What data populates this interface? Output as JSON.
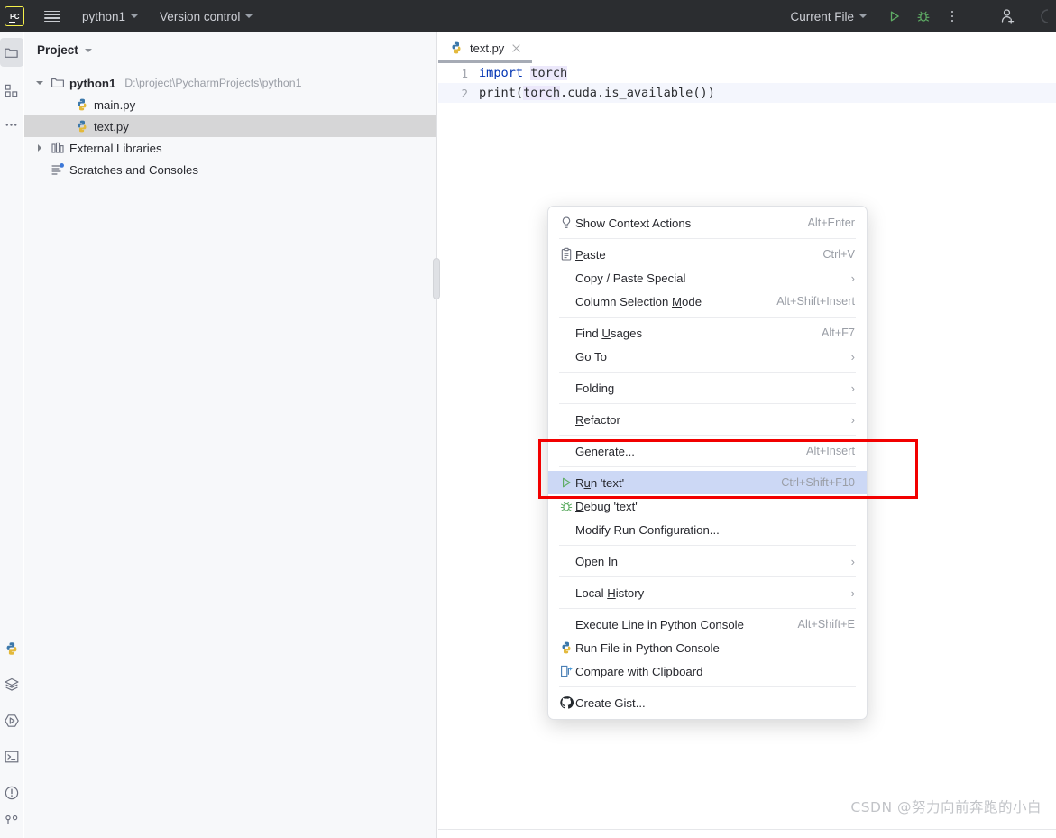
{
  "titlebar": {
    "logo_text": "PC",
    "logo_name": "pycharm-logo",
    "menu_icon": "hamburger-menu-icon",
    "project_name": "python1",
    "version_control": "Version control",
    "run_config": "Current File",
    "run_icon": "run-triangle-icon",
    "debug_icon": "debug-bug-icon",
    "more_icon": "more-vertical-icon",
    "account_icon": "add-user-icon",
    "accent_run_green": "#5fad65",
    "bg": "#2b2d30"
  },
  "rail": {
    "top": [
      {
        "name": "project-folder-icon",
        "label": "Project",
        "selected": true
      },
      {
        "name": "structure-icon",
        "label": "Structure",
        "selected": false
      },
      {
        "name": "more-tool-windows-icon",
        "label": "More",
        "selected": false
      }
    ],
    "bottom": [
      {
        "name": "python-packages-icon",
        "label": "Python Packages"
      },
      {
        "name": "database-layers-icon",
        "label": "Database"
      },
      {
        "name": "run-tool-icon",
        "label": "Run"
      },
      {
        "name": "terminal-icon",
        "label": "Terminal"
      },
      {
        "name": "problems-icon",
        "label": "Problems"
      },
      {
        "name": "git-branch-icon",
        "label": "Git"
      }
    ]
  },
  "project": {
    "header": "Project",
    "tree": [
      {
        "label": "python1",
        "path": "D:\\project\\PycharmProjects\\python1",
        "icon": "folder-icon",
        "twist": "open",
        "depth": 0,
        "bold": true,
        "selected": false
      },
      {
        "label": "main.py",
        "path": "",
        "icon": "python-file-icon",
        "twist": "none",
        "depth": 1,
        "bold": false,
        "selected": false
      },
      {
        "label": "text.py",
        "path": "",
        "icon": "python-file-icon",
        "twist": "none",
        "depth": 1,
        "bold": false,
        "selected": true
      },
      {
        "label": "External Libraries",
        "path": "",
        "icon": "library-icon",
        "twist": "closed",
        "depth": 0,
        "bold": false,
        "selected": false
      },
      {
        "label": "Scratches and Consoles",
        "path": "",
        "icon": "scratches-icon",
        "twist": "none",
        "depth": 0,
        "bold": false,
        "selected": false
      }
    ]
  },
  "editor": {
    "tab": {
      "label": "text.py",
      "icon": "python-file-icon",
      "close": "close-tab-icon"
    },
    "lines": [
      {
        "num": "1",
        "caret": false
      },
      {
        "num": "2",
        "caret": true
      }
    ],
    "code": {
      "line1_kw": "import",
      "line1_ident": "torch",
      "line2": "print(torch.cuda.is_available())",
      "line2_pre": "print(",
      "line2_ident": "torch",
      "line2_post": ".cuda.is_available())"
    }
  },
  "context_menu": {
    "items": [
      {
        "kind": "item",
        "icon": "lightbulb-icon",
        "label": "Show Context Actions",
        "accel": "Alt+Enter",
        "arrow": false,
        "selected": false
      },
      {
        "kind": "sep"
      },
      {
        "kind": "item",
        "icon": "clipboard-paste-icon",
        "label": "Paste",
        "mnemonic": "P",
        "accel": "Ctrl+V",
        "arrow": false,
        "selected": false
      },
      {
        "kind": "item",
        "icon": "",
        "label": "Copy / Paste Special",
        "accel": "",
        "arrow": true,
        "selected": false
      },
      {
        "kind": "item",
        "icon": "",
        "label": "Column Selection Mode",
        "mnemonic": "M",
        "accel": "Alt+Shift+Insert",
        "arrow": false,
        "selected": false
      },
      {
        "kind": "sep"
      },
      {
        "kind": "item",
        "icon": "",
        "label": "Find Usages",
        "mnemonic": "U",
        "accel": "Alt+F7",
        "arrow": false,
        "selected": false
      },
      {
        "kind": "item",
        "icon": "",
        "label": "Go To",
        "accel": "",
        "arrow": true,
        "selected": false
      },
      {
        "kind": "sep"
      },
      {
        "kind": "item",
        "icon": "",
        "label": "Folding",
        "accel": "",
        "arrow": true,
        "selected": false
      },
      {
        "kind": "sep"
      },
      {
        "kind": "item",
        "icon": "",
        "label": "Refactor",
        "mnemonic": "R",
        "accel": "",
        "arrow": true,
        "selected": false
      },
      {
        "kind": "sep"
      },
      {
        "kind": "item",
        "icon": "",
        "label": "Generate...",
        "accel": "Alt+Insert",
        "arrow": false,
        "selected": false
      },
      {
        "kind": "sep"
      },
      {
        "kind": "item",
        "icon": "run-triangle-icon",
        "label": "Run 'text'",
        "mnemonic": "u",
        "accel": "Ctrl+Shift+F10",
        "arrow": false,
        "selected": true
      },
      {
        "kind": "item",
        "icon": "debug-bug-icon",
        "label": "Debug 'text'",
        "mnemonic": "D",
        "accel": "",
        "arrow": false,
        "selected": false
      },
      {
        "kind": "item",
        "icon": "",
        "label": "Modify Run Configuration...",
        "accel": "",
        "arrow": false,
        "selected": false
      },
      {
        "kind": "sep"
      },
      {
        "kind": "item",
        "icon": "",
        "label": "Open In",
        "accel": "",
        "arrow": true,
        "selected": false
      },
      {
        "kind": "sep"
      },
      {
        "kind": "item",
        "icon": "",
        "label": "Local History",
        "mnemonic": "H",
        "accel": "",
        "arrow": true,
        "selected": false
      },
      {
        "kind": "sep"
      },
      {
        "kind": "item",
        "icon": "",
        "label": "Execute Line in Python Console",
        "accel": "Alt+Shift+E",
        "arrow": false,
        "selected": false
      },
      {
        "kind": "item",
        "icon": "python-file-icon",
        "label": "Run File in Python Console",
        "accel": "",
        "arrow": false,
        "selected": false
      },
      {
        "kind": "item",
        "icon": "compare-clipboard-icon",
        "label": "Compare with Clipboard",
        "mnemonic": "b",
        "accel": "",
        "arrow": false,
        "selected": false
      },
      {
        "kind": "sep"
      },
      {
        "kind": "item",
        "icon": "github-icon",
        "label": "Create Gist...",
        "accel": "",
        "arrow": false,
        "selected": false
      }
    ]
  },
  "annotation": {
    "name": "red-highlight-box",
    "color": "#f20000"
  },
  "watermark": {
    "text": "CSDN @努力向前奔跑的小白"
  }
}
